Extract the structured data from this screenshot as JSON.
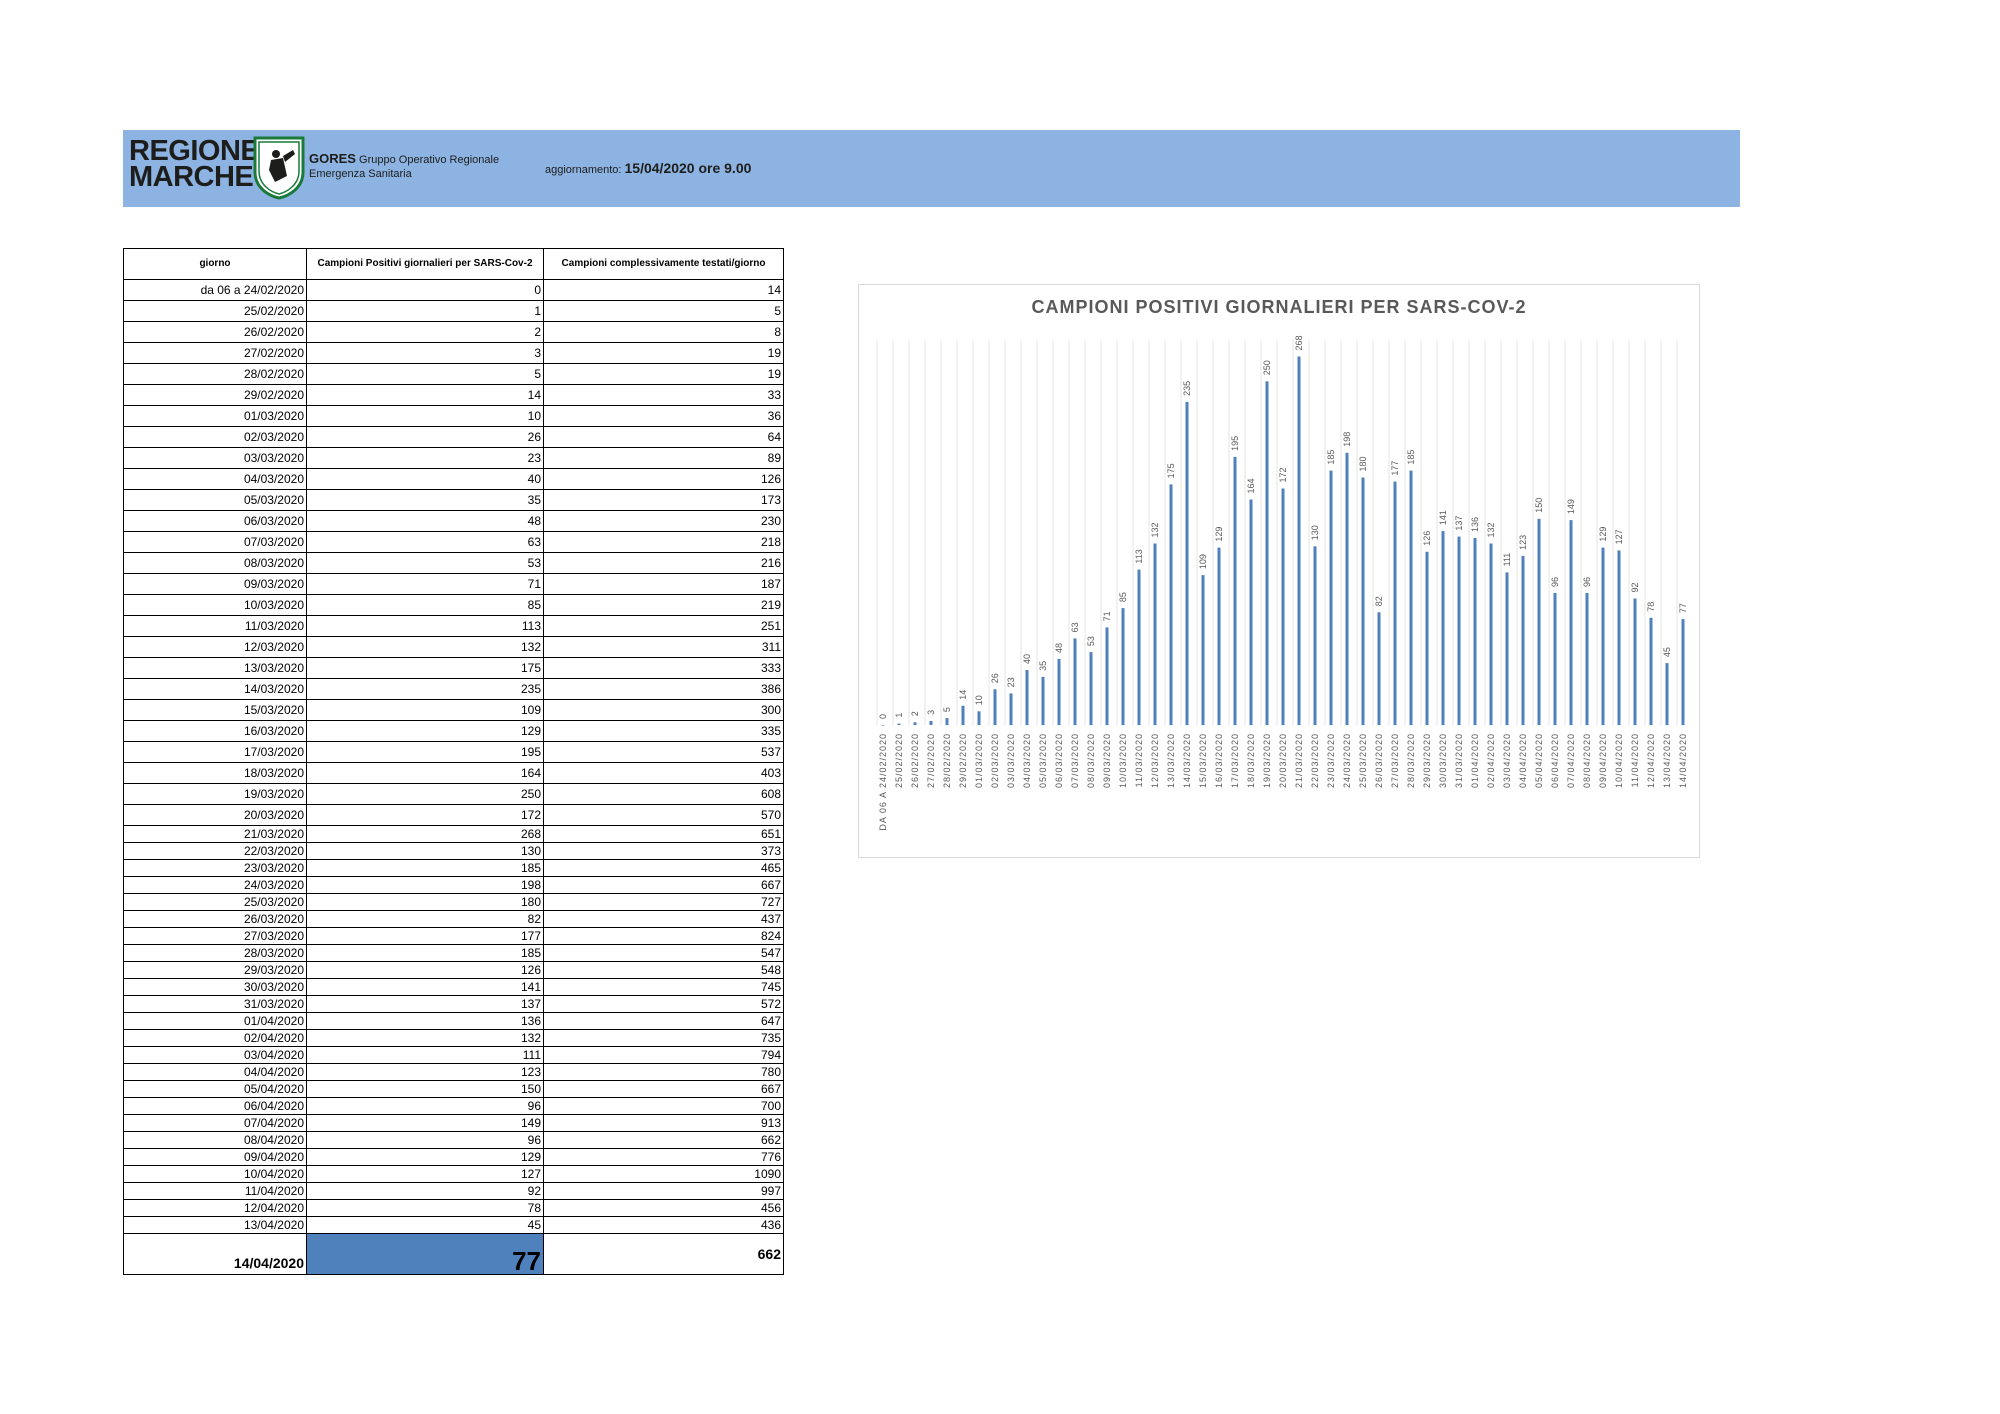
{
  "header": {
    "logo_line1": "REGIONE",
    "logo_line2": "MARCHE",
    "gores_name": "GORES",
    "gores_line1": "Gruppo Operativo Regionale",
    "gores_line2": "Emergenza Sanitaria",
    "update_label": "aggiornamento:",
    "update_value": "15/04/2020 ore 9.00"
  },
  "table": {
    "headers": [
      "giorno",
      "Campioni Positivi giornalieri per SARS-Cov-2",
      "Campioni complessivamente testati/giorno"
    ],
    "rows": [
      [
        "da 06 a 24/02/2020",
        "0",
        "14"
      ],
      [
        "25/02/2020",
        "1",
        "5"
      ],
      [
        "26/02/2020",
        "2",
        "8"
      ],
      [
        "27/02/2020",
        "3",
        "19"
      ],
      [
        "28/02/2020",
        "5",
        "19"
      ],
      [
        "29/02/2020",
        "14",
        "33"
      ],
      [
        "01/03/2020",
        "10",
        "36"
      ],
      [
        "02/03/2020",
        "26",
        "64"
      ],
      [
        "03/03/2020",
        "23",
        "89"
      ],
      [
        "04/03/2020",
        "40",
        "126"
      ],
      [
        "05/03/2020",
        "35",
        "173"
      ],
      [
        "06/03/2020",
        "48",
        "230"
      ],
      [
        "07/03/2020",
        "63",
        "218"
      ],
      [
        "08/03/2020",
        "53",
        "216"
      ],
      [
        "09/03/2020",
        "71",
        "187"
      ],
      [
        "10/03/2020",
        "85",
        "219"
      ],
      [
        "11/03/2020",
        "113",
        "251"
      ],
      [
        "12/03/2020",
        "132",
        "311"
      ],
      [
        "13/03/2020",
        "175",
        "333"
      ],
      [
        "14/03/2020",
        "235",
        "386"
      ],
      [
        "15/03/2020",
        "109",
        "300"
      ],
      [
        "16/03/2020",
        "129",
        "335"
      ],
      [
        "17/03/2020",
        "195",
        "537"
      ],
      [
        "18/03/2020",
        "164",
        "403"
      ],
      [
        "19/03/2020",
        "250",
        "608"
      ],
      [
        "20/03/2020",
        "172",
        "570"
      ],
      [
        "21/03/2020",
        "268",
        "651"
      ],
      [
        "22/03/2020",
        "130",
        "373"
      ],
      [
        "23/03/2020",
        "185",
        "465"
      ],
      [
        "24/03/2020",
        "198",
        "667"
      ],
      [
        "25/03/2020",
        "180",
        "727"
      ],
      [
        "26/03/2020",
        "82",
        "437"
      ],
      [
        "27/03/2020",
        "177",
        "824"
      ],
      [
        "28/03/2020",
        "185",
        "547"
      ],
      [
        "29/03/2020",
        "126",
        "548"
      ],
      [
        "30/03/2020",
        "141",
        "745"
      ],
      [
        "31/03/2020",
        "137",
        "572"
      ],
      [
        "01/04/2020",
        "136",
        "647"
      ],
      [
        "02/04/2020",
        "132",
        "735"
      ],
      [
        "03/04/2020",
        "111",
        "794"
      ],
      [
        "04/04/2020",
        "123",
        "780"
      ],
      [
        "05/04/2020",
        "150",
        "667"
      ],
      [
        "06/04/2020",
        "96",
        "700"
      ],
      [
        "07/04/2020",
        "149",
        "913"
      ],
      [
        "08/04/2020",
        "96",
        "662"
      ],
      [
        "09/04/2020",
        "129",
        "776"
      ],
      [
        "10/04/2020",
        "127",
        "1090"
      ],
      [
        "11/04/2020",
        "92",
        "997"
      ],
      [
        "12/04/2020",
        "78",
        "456"
      ],
      [
        "13/04/2020",
        "45",
        "436"
      ]
    ],
    "final_row": [
      "14/04/2020",
      "77",
      "662"
    ]
  },
  "chart_data": {
    "type": "bar",
    "title": "CAMPIONI POSITIVI GIORNALIERI PER SARS-COV-2",
    "categories": [
      "DA 06 A 24/02/2020",
      "25/02/2020",
      "26/02/2020",
      "27/02/2020",
      "28/02/2020",
      "29/02/2020",
      "01/03/2020",
      "02/03/2020",
      "03/03/2020",
      "04/03/2020",
      "05/03/2020",
      "06/03/2020",
      "07/03/2020",
      "08/03/2020",
      "09/03/2020",
      "10/03/2020",
      "11/03/2020",
      "12/03/2020",
      "13/03/2020",
      "14/03/2020",
      "15/03/2020",
      "16/03/2020",
      "17/03/2020",
      "18/03/2020",
      "19/03/2020",
      "20/03/2020",
      "21/03/2020",
      "22/03/2020",
      "23/03/2020",
      "24/03/2020",
      "25/03/2020",
      "26/03/2020",
      "27/03/2020",
      "28/03/2020",
      "29/03/2020",
      "30/03/2020",
      "31/03/2020",
      "01/04/2020",
      "02/04/2020",
      "03/04/2020",
      "04/04/2020",
      "05/04/2020",
      "06/04/2020",
      "07/04/2020",
      "08/04/2020",
      "09/04/2020",
      "10/04/2020",
      "11/04/2020",
      "12/04/2020",
      "13/04/2020",
      "14/04/2020"
    ],
    "values": [
      0,
      1,
      2,
      3,
      5,
      14,
      10,
      26,
      23,
      40,
      35,
      48,
      63,
      53,
      71,
      85,
      113,
      132,
      175,
      235,
      109,
      129,
      195,
      164,
      250,
      172,
      268,
      130,
      185,
      198,
      180,
      82,
      177,
      185,
      126,
      141,
      137,
      136,
      132,
      111,
      123,
      150,
      96,
      149,
      96,
      129,
      127,
      92,
      78,
      45,
      77
    ],
    "ylim": [
      0,
      280
    ],
    "bar_color": "#4f81bd",
    "grid": true,
    "legend": "none"
  }
}
